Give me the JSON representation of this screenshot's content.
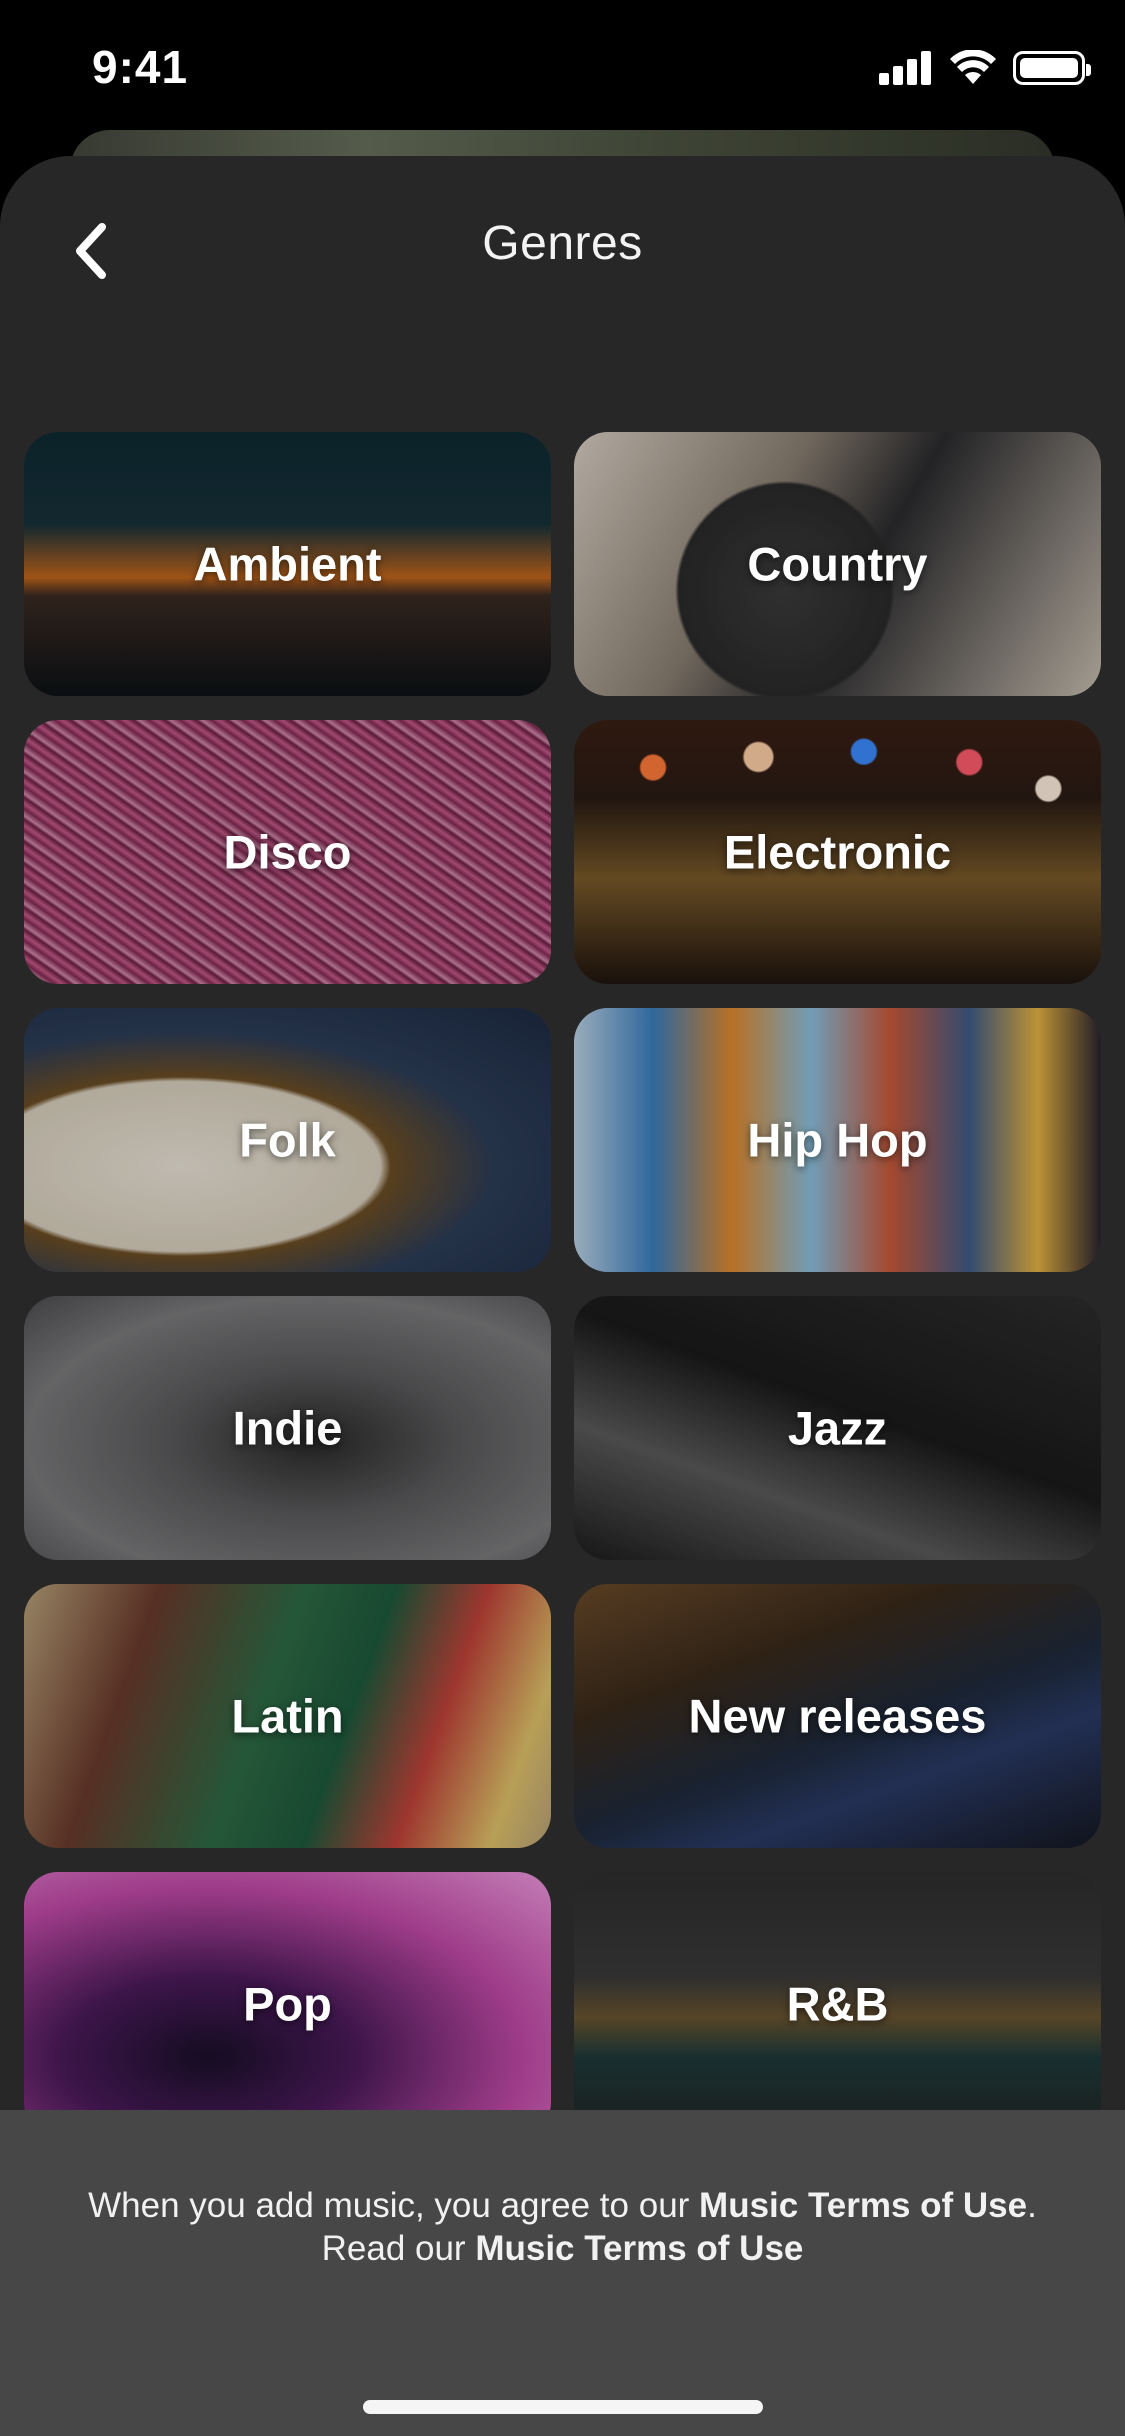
{
  "status_bar": {
    "time": "9:41",
    "icons": [
      "cellular-signal-icon",
      "wifi-icon",
      "battery-icon"
    ]
  },
  "header": {
    "title": "Genres",
    "back_icon": "chevron-left-icon"
  },
  "genres": [
    {
      "label": "Ambient"
    },
    {
      "label": "Country"
    },
    {
      "label": "Disco"
    },
    {
      "label": "Electronic"
    },
    {
      "label": "Folk"
    },
    {
      "label": "Hip Hop"
    },
    {
      "label": "Indie"
    },
    {
      "label": "Jazz"
    },
    {
      "label": "Latin"
    },
    {
      "label": "New releases"
    },
    {
      "label": "Pop"
    },
    {
      "label": "R&B"
    }
  ],
  "footer": {
    "terms_prefix": "When you add music, you agree to our ",
    "terms_link": "Music Terms of Use",
    "terms_period": ".",
    "read_prefix": "Read our ",
    "read_link": "Music Terms of Use"
  },
  "colors": {
    "sheet_background": "#272727",
    "footer_background": "#474747",
    "text": "#ffffff"
  }
}
